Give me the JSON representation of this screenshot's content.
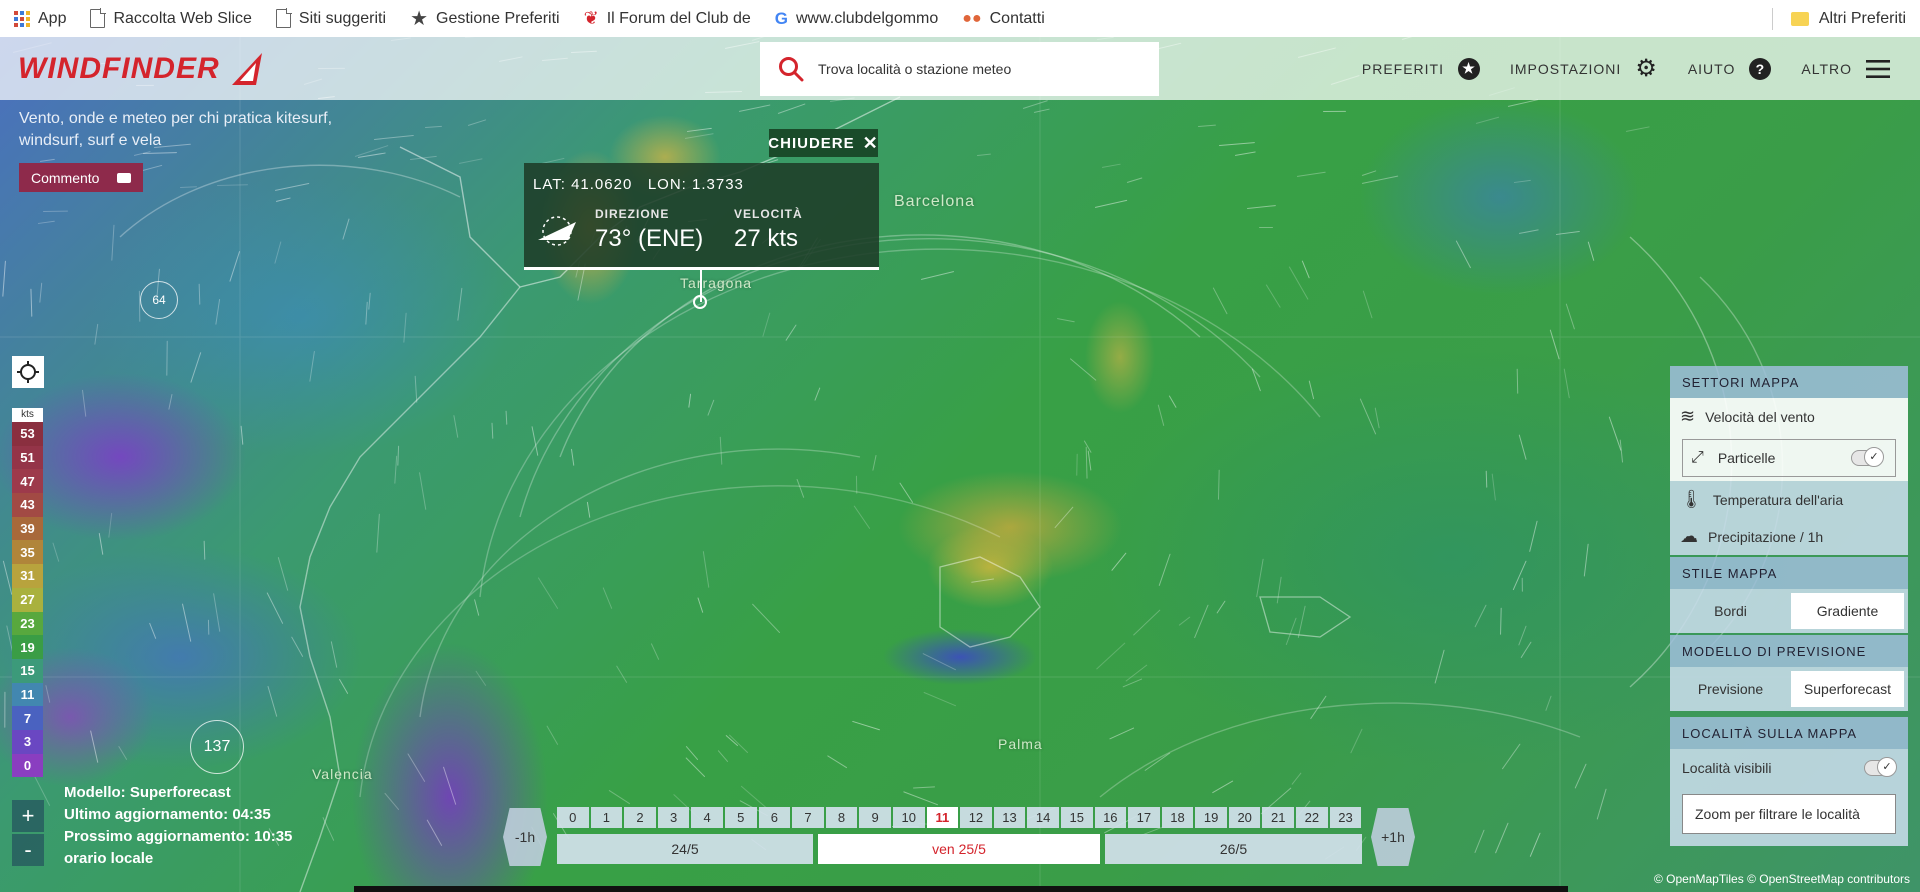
{
  "bookmarks": {
    "items": [
      {
        "label": "App",
        "icon": "apps-grid-icon"
      },
      {
        "label": "Raccolta Web Slice",
        "icon": "document-icon"
      },
      {
        "label": "Siti suggeriti",
        "icon": "document-icon"
      },
      {
        "label": "Gestione Preferiti",
        "icon": "star-icon"
      },
      {
        "label": "Il Forum del Club de",
        "icon": "heart-logo-icon"
      },
      {
        "label": "www.clubdelgommo",
        "icon": "google-icon"
      },
      {
        "label": "Contatti",
        "icon": "contacts-icon"
      }
    ],
    "other": "Altri Preferiti"
  },
  "header": {
    "logo": "WINDFINDER",
    "search_placeholder": "Trova località o stazione meteo",
    "nav": {
      "favorites": "PREFERITI",
      "settings": "IMPOSTAZIONI",
      "help": "AIUTO",
      "more": "ALTRO"
    }
  },
  "intro": {
    "subtitle": "Vento, onde e meteo per chi pratica kitesurf, windsurf, surf e vela",
    "comment_button": "Commento"
  },
  "map": {
    "cities": {
      "barcelona": "Barcelona",
      "tarragona": "Tarragona",
      "valencia": "Valencia",
      "palma": "Palma"
    },
    "markers": {
      "a": "64",
      "b": "137"
    }
  },
  "popup": {
    "close": "CHIUDERE",
    "lat_label": "LAT:",
    "lat": "41.0620",
    "lon_label": "LON:",
    "lon": "1.3733",
    "direction_label": "DIREZIONE",
    "direction": "73° (ENE)",
    "speed_label": "VELOCITÀ",
    "speed": "27 kts"
  },
  "legend": {
    "unit": "kts",
    "values": [
      {
        "v": "53",
        "c": "#8a2f3f"
      },
      {
        "v": "51",
        "c": "#943448"
      },
      {
        "v": "47",
        "c": "#9d3a4b"
      },
      {
        "v": "43",
        "c": "#a24a44"
      },
      {
        "v": "39",
        "c": "#a8693a"
      },
      {
        "v": "35",
        "c": "#b0853a"
      },
      {
        "v": "31",
        "c": "#b8a33d"
      },
      {
        "v": "27",
        "c": "#a9b13e"
      },
      {
        "v": "23",
        "c": "#58a83e"
      },
      {
        "v": "19",
        "c": "#3a9d45"
      },
      {
        "v": "15",
        "c": "#3c9a7a"
      },
      {
        "v": "11",
        "c": "#4287b0"
      },
      {
        "v": "7",
        "c": "#4a62c0"
      },
      {
        "v": "3",
        "c": "#6a47c2"
      },
      {
        "v": "0",
        "c": "#8a3ec0"
      }
    ]
  },
  "zoom": {
    "in": "+",
    "out": "-"
  },
  "model_info": {
    "model": "Modello: Superforecast",
    "last_update": "Ultimo aggiornamento: 04:35",
    "next_update": "Prossimo aggiornamento: 10:35",
    "local_time": "orario locale"
  },
  "panel": {
    "sectors_title": "SETTORI MAPPA",
    "wind_speed": "Velocità del vento",
    "particles": "Particelle",
    "air_temp": "Temperatura dell'aria",
    "precip": "Precipitazione / 1h",
    "style_title": "STILE MAPPA",
    "style_borders": "Bordi",
    "style_gradient": "Gradiente",
    "model_title": "MODELLO DI PREVISIONE",
    "model_forecast": "Previsione",
    "model_super": "Superforecast",
    "places_title": "LOCALITÀ SULLA MAPPA",
    "places_visible": "Località visibili",
    "zoom_filter": "Zoom per filtrare le località"
  },
  "timeline": {
    "prev": "-1h",
    "next": "+1h",
    "hours": [
      "0",
      "1",
      "2",
      "3",
      "4",
      "5",
      "6",
      "7",
      "8",
      "9",
      "10",
      "11",
      "12",
      "13",
      "14",
      "15",
      "16",
      "17",
      "18",
      "19",
      "20",
      "21",
      "22",
      "23"
    ],
    "selected_hour": "11",
    "days": [
      "24/5",
      "ven 25/5",
      "26/5"
    ],
    "selected_day": "ven 25/5"
  },
  "credits": "© OpenMapTiles © OpenStreetMap contributors"
}
